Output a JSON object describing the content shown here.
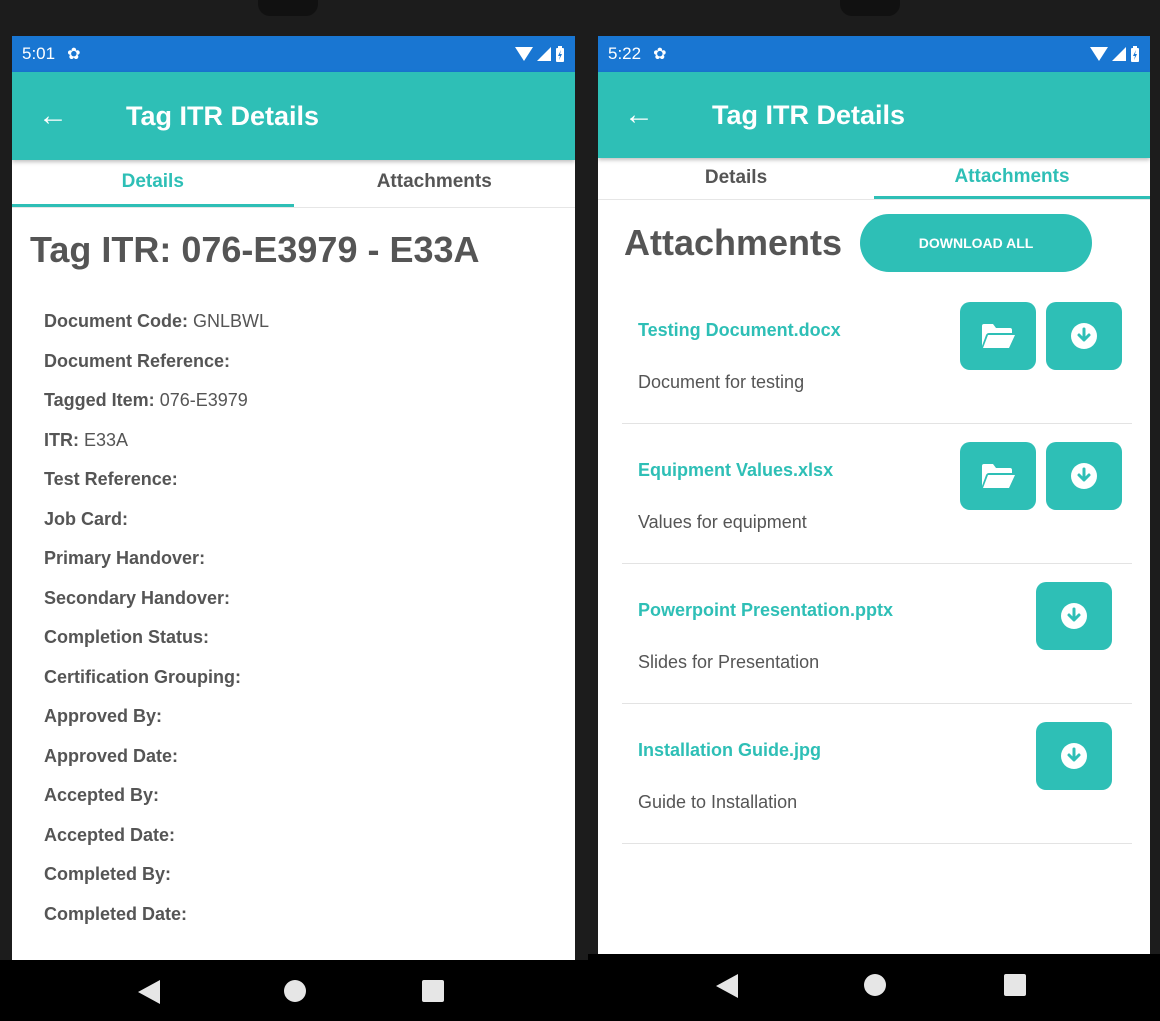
{
  "colors": {
    "status_bar": "#1976d2",
    "app_bar": "#2ebfb6",
    "accent": "#2ebfb6",
    "text": "#555555"
  },
  "left_screen": {
    "status": {
      "time": "5:01"
    },
    "appbar": {
      "back_icon": "arrow-back-icon",
      "title": "Tag ITR Details"
    },
    "tabs": [
      {
        "label": "Details",
        "active": true
      },
      {
        "label": "Attachments",
        "active": false
      }
    ],
    "heading": "Tag ITR: 076-E3979 - E33A",
    "fields": [
      {
        "label": "Document Code:",
        "value": "GNLBWL"
      },
      {
        "label": "Document Reference:",
        "value": ""
      },
      {
        "label": "Tagged Item:",
        "value": "076-E3979"
      },
      {
        "label": "ITR:",
        "value": "E33A"
      },
      {
        "label": "Test Reference:",
        "value": ""
      },
      {
        "label": "Job Card:",
        "value": ""
      },
      {
        "label": "Primary Handover:",
        "value": ""
      },
      {
        "label": "Secondary Handover:",
        "value": ""
      },
      {
        "label": "Completion Status:",
        "value": ""
      },
      {
        "label": "Certification Grouping:",
        "value": ""
      },
      {
        "label": "Approved By:",
        "value": ""
      },
      {
        "label": "Approved Date:",
        "value": ""
      },
      {
        "label": "Accepted By:",
        "value": ""
      },
      {
        "label": "Accepted Date:",
        "value": ""
      },
      {
        "label": "Completed By:",
        "value": ""
      },
      {
        "label": "Completed Date:",
        "value": ""
      }
    ]
  },
  "right_screen": {
    "status": {
      "time": "5:22"
    },
    "appbar": {
      "back_icon": "arrow-back-icon",
      "title": "Tag ITR Details"
    },
    "tabs": [
      {
        "label": "Details",
        "active": false
      },
      {
        "label": "Attachments",
        "active": true
      }
    ],
    "heading": "Attachments",
    "download_all_label": "DOWNLOAD ALL",
    "attachments": [
      {
        "name": "Testing Document.docx",
        "description": "Document for testing",
        "can_open": true
      },
      {
        "name": "Equipment Values.xlsx",
        "description": "Values for equipment",
        "can_open": true
      },
      {
        "name": "Powerpoint Presentation.pptx",
        "description": "Slides for Presentation",
        "can_open": false
      },
      {
        "name": "Installation Guide.jpg",
        "description": "Guide to Installation",
        "can_open": false
      }
    ]
  }
}
